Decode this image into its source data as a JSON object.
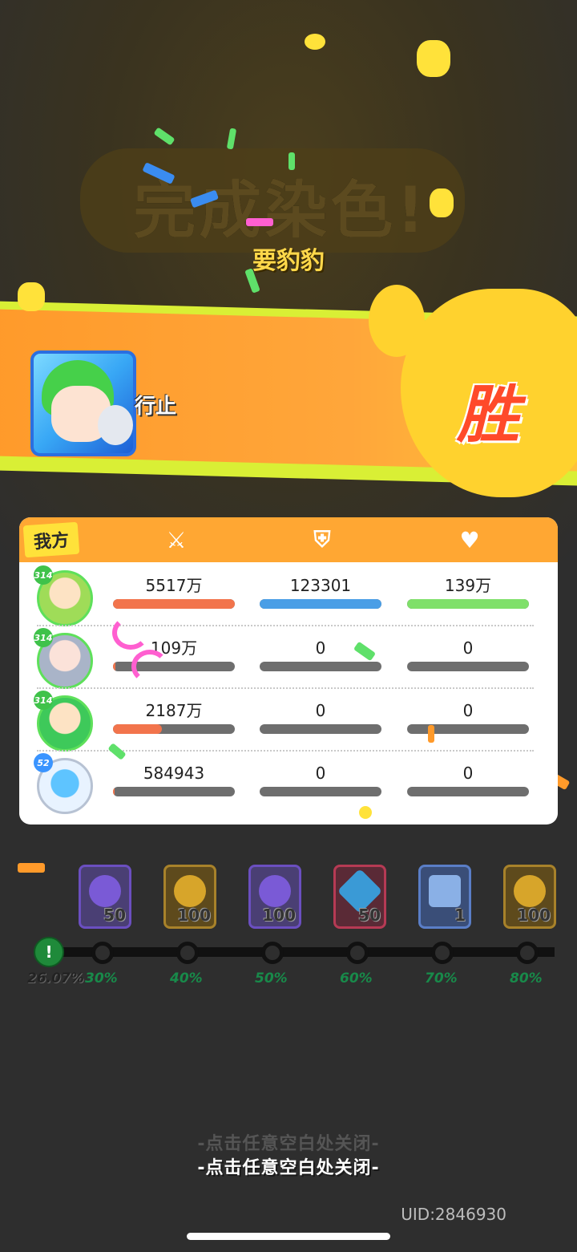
{
  "result": {
    "title_text": "完成染色!",
    "top_player_name": "要豹豹",
    "main_player_name": "行止",
    "victory_text": "胜"
  },
  "stats": {
    "side_label": "我方",
    "header_icons": [
      "sword-icon",
      "shield-icon",
      "heart-plus-icon"
    ],
    "rows": [
      {
        "level": "314",
        "attack": "5517万",
        "defense": "123301",
        "heal": "139万",
        "attack_ratio": 1.0,
        "defense_ratio": 1.0,
        "heal_ratio": 1.0
      },
      {
        "level": "314",
        "attack": "109万",
        "defense": "0",
        "heal": "0",
        "attack_ratio": 0.02,
        "defense_ratio": 0,
        "heal_ratio": 0
      },
      {
        "level": "314",
        "attack": "2187万",
        "defense": "0",
        "heal": "0",
        "attack_ratio": 0.4,
        "defense_ratio": 0,
        "heal_ratio": 0
      },
      {
        "level": "52",
        "attack": "584943",
        "defense": "0",
        "heal": "0",
        "attack_ratio": 0.01,
        "defense_ratio": 0,
        "heal_ratio": 0
      }
    ],
    "colors": {
      "attack": "#f2744c",
      "defense": "#4a9ee6",
      "heal": "#7fe06a",
      "empty": "#6e6e6e"
    }
  },
  "rewards": {
    "items": [
      {
        "icon": "purple-crayon-icon",
        "qty": "50"
      },
      {
        "icon": "gold-coin-icon",
        "qty": "100"
      },
      {
        "icon": "purple-crayon-icon",
        "qty": "100"
      },
      {
        "icon": "blue-diamond-icon",
        "qty": "50"
      },
      {
        "icon": "blue-box-icon",
        "qty": "1"
      },
      {
        "icon": "gold-coin-icon",
        "qty": "100"
      }
    ],
    "current_progress": "26.07%",
    "current_fraction": 0.2607,
    "milestones": [
      "30%",
      "40%",
      "50%",
      "60%",
      "70%",
      "80%"
    ]
  },
  "footer": {
    "close_hint": "-点击任意空白处关闭-",
    "uid": "UID:2846930"
  }
}
